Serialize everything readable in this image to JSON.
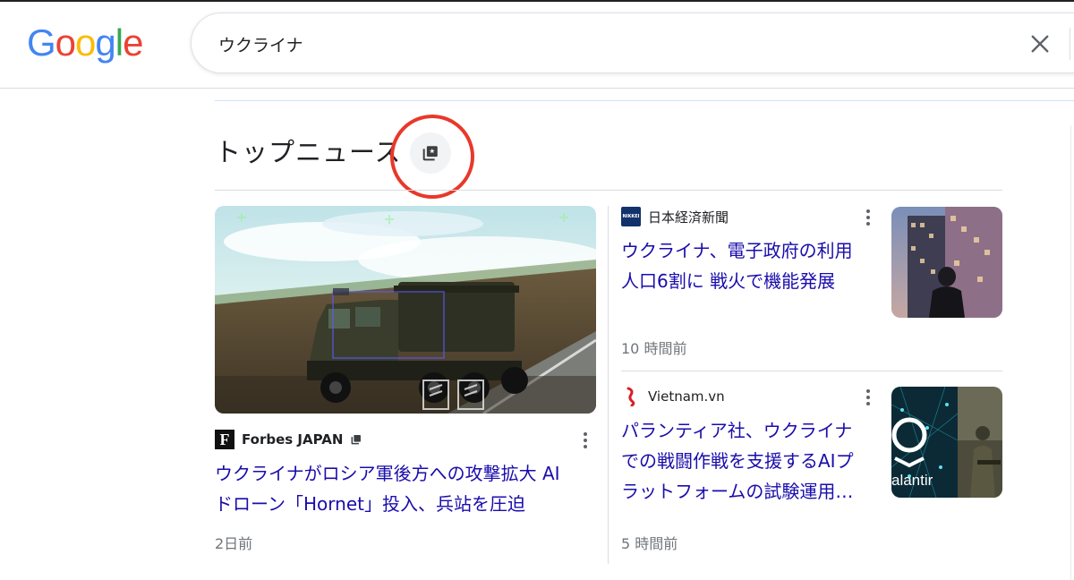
{
  "header": {
    "logo_letters": [
      "G",
      "o",
      "o",
      "g",
      "l",
      "e"
    ],
    "logo_colors": [
      "#4285F4",
      "#EA4335",
      "#FBBC05",
      "#4285F4",
      "#34A853",
      "#EA4335"
    ],
    "search_value": "ウクライナ",
    "clear_icon": "close-icon"
  },
  "top_news": {
    "title": "トップニュース",
    "title_icon": "full-coverage-icon",
    "highlight_color": "#e8382a"
  },
  "articles": [
    {
      "source": "Forbes JAPAN",
      "source_logo_letter": "F",
      "headline_line1": "ウクライナがロシア軍後方への攻撃拡大 AI",
      "headline_line2": "ドローン「Hornet」投入、兵站を圧迫",
      "time": "2日前"
    },
    {
      "source": "日本経済新聞",
      "source_logo_text": "NIKKEI",
      "headline_line1": "ウクライナ、電子政府の利用",
      "headline_line2": "人口6割に 戦火で機能発展",
      "time": "10 時間前"
    },
    {
      "source": "Vietnam.vn",
      "headline_line1": "パランティア社、ウクライナ",
      "headline_line2": "での戦闘作戦を支援するAIプ",
      "headline_line3": "ラットフォームの試験運用…",
      "thumb_text": "alantir",
      "time": "5 時間前"
    }
  ],
  "colors": {
    "link": "#1a0dab",
    "meta": "#70757a"
  }
}
